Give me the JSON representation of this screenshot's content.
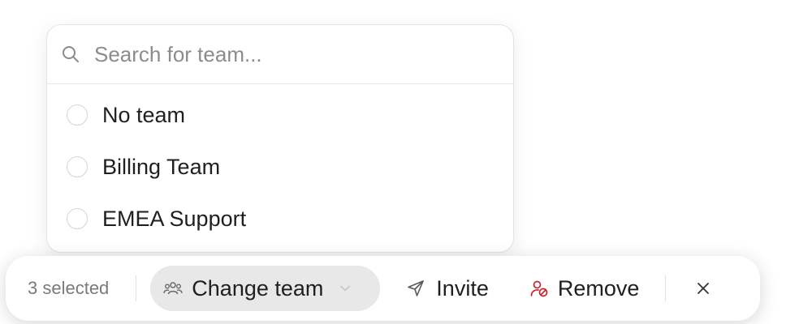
{
  "team_picker": {
    "search": {
      "placeholder": "Search for team...",
      "value": "",
      "icon": "search-icon"
    },
    "options": [
      {
        "label": "No team",
        "selected": false
      },
      {
        "label": "Billing Team",
        "selected": false
      },
      {
        "label": "EMEA Support",
        "selected": false
      }
    ]
  },
  "action_bar": {
    "selected_count_label": "3 selected",
    "change_team": {
      "label": "Change team",
      "icon": "users-icon",
      "chevron": "chevron-down-icon"
    },
    "invite": {
      "label": "Invite",
      "icon": "send-icon"
    },
    "remove": {
      "label": "Remove",
      "icon": "remove-user-icon",
      "icon_color": "#c4242b"
    },
    "close": {
      "icon": "close-icon"
    }
  },
  "colors": {
    "change_team_bg": "#e8e8e8",
    "remove_icon": "#c4242b",
    "muted_text": "#7a7a7a"
  }
}
